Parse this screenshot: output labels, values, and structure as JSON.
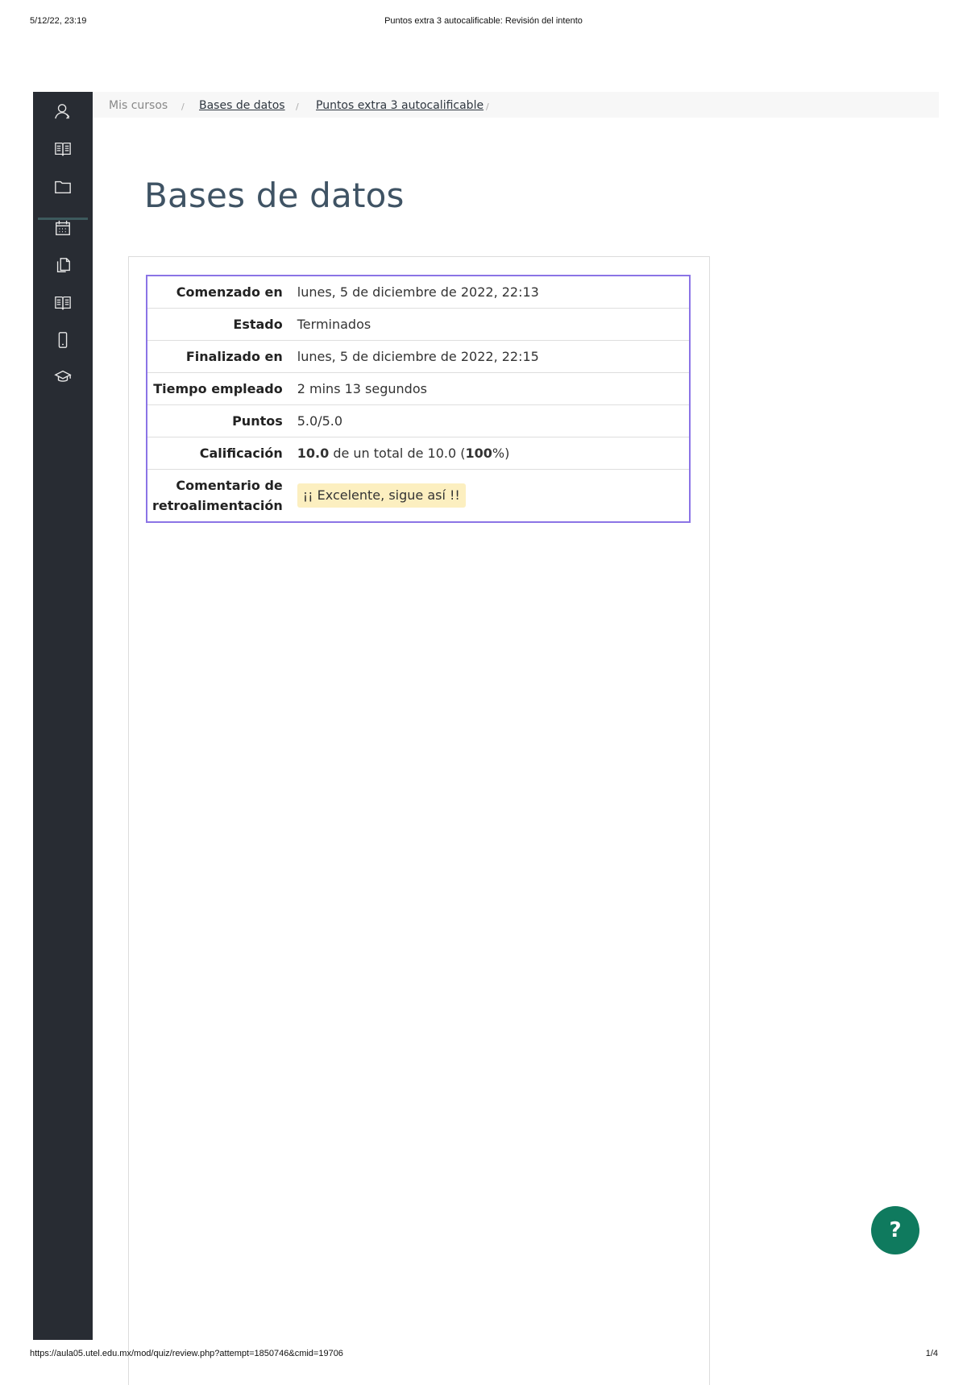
{
  "print_header": {
    "datetime": "5/12/22, 23:19",
    "page_title": "Puntos extra 3 autocalificable: Revisión del intento"
  },
  "print_footer": {
    "url": "https://aula05.utel.edu.mx/mod/quiz/review.php?attempt=1850746&cmid=19706",
    "page_counter": "1/4"
  },
  "sidebar": {
    "icons": [
      "user-icon",
      "book-open-icon",
      "folder-icon",
      "calendar-icon",
      "documents-icon",
      "book-icon",
      "mobile-phone-icon",
      "graduation-cap-icon"
    ]
  },
  "breadcrumb": {
    "items": [
      {
        "label": "Mis cursos"
      },
      {
        "label": "Bases de datos"
      },
      {
        "label": "Puntos extra 3 autocalificable"
      }
    ],
    "separator": "/"
  },
  "page_title": "Bases de datos",
  "summary": {
    "rows": [
      {
        "label": "Comenzado en",
        "value": "lunes, 5 de diciembre de 2022, 22:13"
      },
      {
        "label": "Estado",
        "value": "Terminados"
      },
      {
        "label": "Finalizado en",
        "value": "lunes, 5 de diciembre de 2022, 22:15"
      },
      {
        "label": "Tiempo empleado",
        "value": "2 mins 13 segundos"
      },
      {
        "label": "Puntos",
        "value": "5.0/5.0"
      },
      {
        "label": "Calificación",
        "grade": "10.0",
        "grade_middle": " de un total de 10.0 (",
        "grade_percent": "100",
        "grade_suffix": "%)"
      },
      {
        "label": "Comentario de retroalimentación",
        "value": "¡¡ Excelente, sigue así !!"
      }
    ]
  },
  "help_button": {
    "label": "?"
  },
  "colors": {
    "sidebar_bg": "#282c33",
    "title": "#3f5364",
    "table_border": "#8b74e6",
    "feedback_bg": "#fcefc0",
    "help_button_bg": "#0f7a5e"
  }
}
